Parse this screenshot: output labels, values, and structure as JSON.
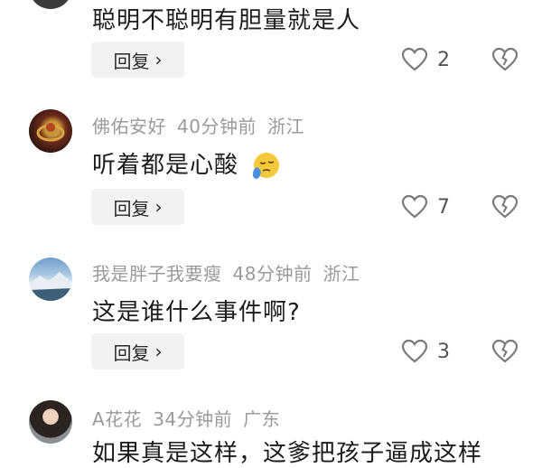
{
  "comments": [
    {
      "text": "聪明不聪明有胆量就是人",
      "reply_label": "回复",
      "like_count": "2"
    },
    {
      "author": "佛佑安好",
      "time": "40分钟前",
      "location": "浙江",
      "text": "听着都是心酸",
      "emoji": "sad-relieved-face-emoji",
      "reply_label": "回复",
      "like_count": "7"
    },
    {
      "author": "我是胖子我要瘦",
      "time": "48分钟前",
      "location": "浙江",
      "text": "这是谁什么事件啊?",
      "reply_label": "回复",
      "like_count": "3"
    },
    {
      "author": "A花花",
      "time": "34分钟前",
      "location": "广东",
      "text": "如果真是这样，这爹把孩子逼成这样"
    }
  ],
  "colors": {
    "meta": "#9a9a9a",
    "reply_bg": "#f2f2f2",
    "icon": "#7a7a7a"
  }
}
